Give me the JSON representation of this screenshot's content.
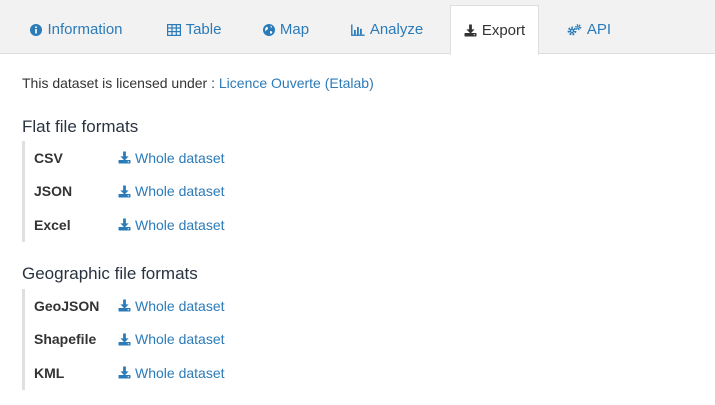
{
  "tabs": [
    {
      "label": "Information",
      "icon": "info-circle-icon"
    },
    {
      "label": "Table",
      "icon": "table-icon"
    },
    {
      "label": "Map",
      "icon": "globe-icon"
    },
    {
      "label": "Analyze",
      "icon": "bar-chart-icon"
    },
    {
      "label": "Export",
      "icon": "download-icon",
      "active": true
    },
    {
      "label": "API",
      "icon": "cogs-icon"
    }
  ],
  "license": {
    "prefix": "This dataset is licensed under : ",
    "link": "Licence Ouverte (Etalab)"
  },
  "flat": {
    "title": "Flat file formats",
    "items": [
      {
        "format": "CSV",
        "link": "Whole dataset"
      },
      {
        "format": "JSON",
        "link": "Whole dataset"
      },
      {
        "format": "Excel",
        "link": "Whole dataset"
      }
    ]
  },
  "geo": {
    "title": "Geographic file formats",
    "items": [
      {
        "format": "GeoJSON",
        "link": "Whole dataset"
      },
      {
        "format": "Shapefile",
        "link": "Whole dataset"
      },
      {
        "format": "KML",
        "link": "Whole dataset"
      }
    ]
  },
  "colors": {
    "link": "#2b7bb9",
    "tabbar": "#f2f2f2",
    "border": "#dedede"
  }
}
